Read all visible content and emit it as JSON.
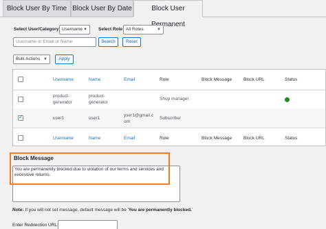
{
  "tabs": [
    {
      "label": "Block User By Time"
    },
    {
      "label": "Block User By Date"
    },
    {
      "label": "Block User Permanent"
    }
  ],
  "filters": {
    "category_label": "Select User/Category:",
    "category_value": "Username",
    "role_label": "Select Role:",
    "role_value": "All Roles",
    "search_placeholder": "Username or Email or Name",
    "search_button": "Search",
    "reset_button": "Reset"
  },
  "bulk": {
    "select_value": "Bulk Actions",
    "apply_button": "Apply"
  },
  "table": {
    "columns": [
      "Username",
      "Name",
      "Email",
      "Role",
      "Block Message",
      "Block URL",
      "Status"
    ],
    "rows": [
      {
        "username": "product-\ngenerator",
        "name": "product-\ngenerator",
        "email": "",
        "role": "Shop manager",
        "block_message": "",
        "block_url": "",
        "status": "active",
        "checked": false
      },
      {
        "username": "user1",
        "name": "user1",
        "email": "yser1@gmail.c\nom",
        "role": "Subscriber",
        "block_message": "",
        "block_url": "",
        "status": "",
        "checked": true
      }
    ]
  },
  "block_message": {
    "title": "Block Message",
    "text": "You are permanently blocked due to violation of our terms and services and excessive returns."
  },
  "note": {
    "prefix": "Note:",
    "text": " If you will not set message, default message will be '",
    "default_message": "You are permanently blocked.",
    "suffix": "'"
  },
  "redirect": {
    "label": "Enter Redirection URL:"
  },
  "colors": {
    "accent": "#2271b1",
    "highlight": "#f07b24",
    "status_active": "#1e8e1e"
  }
}
